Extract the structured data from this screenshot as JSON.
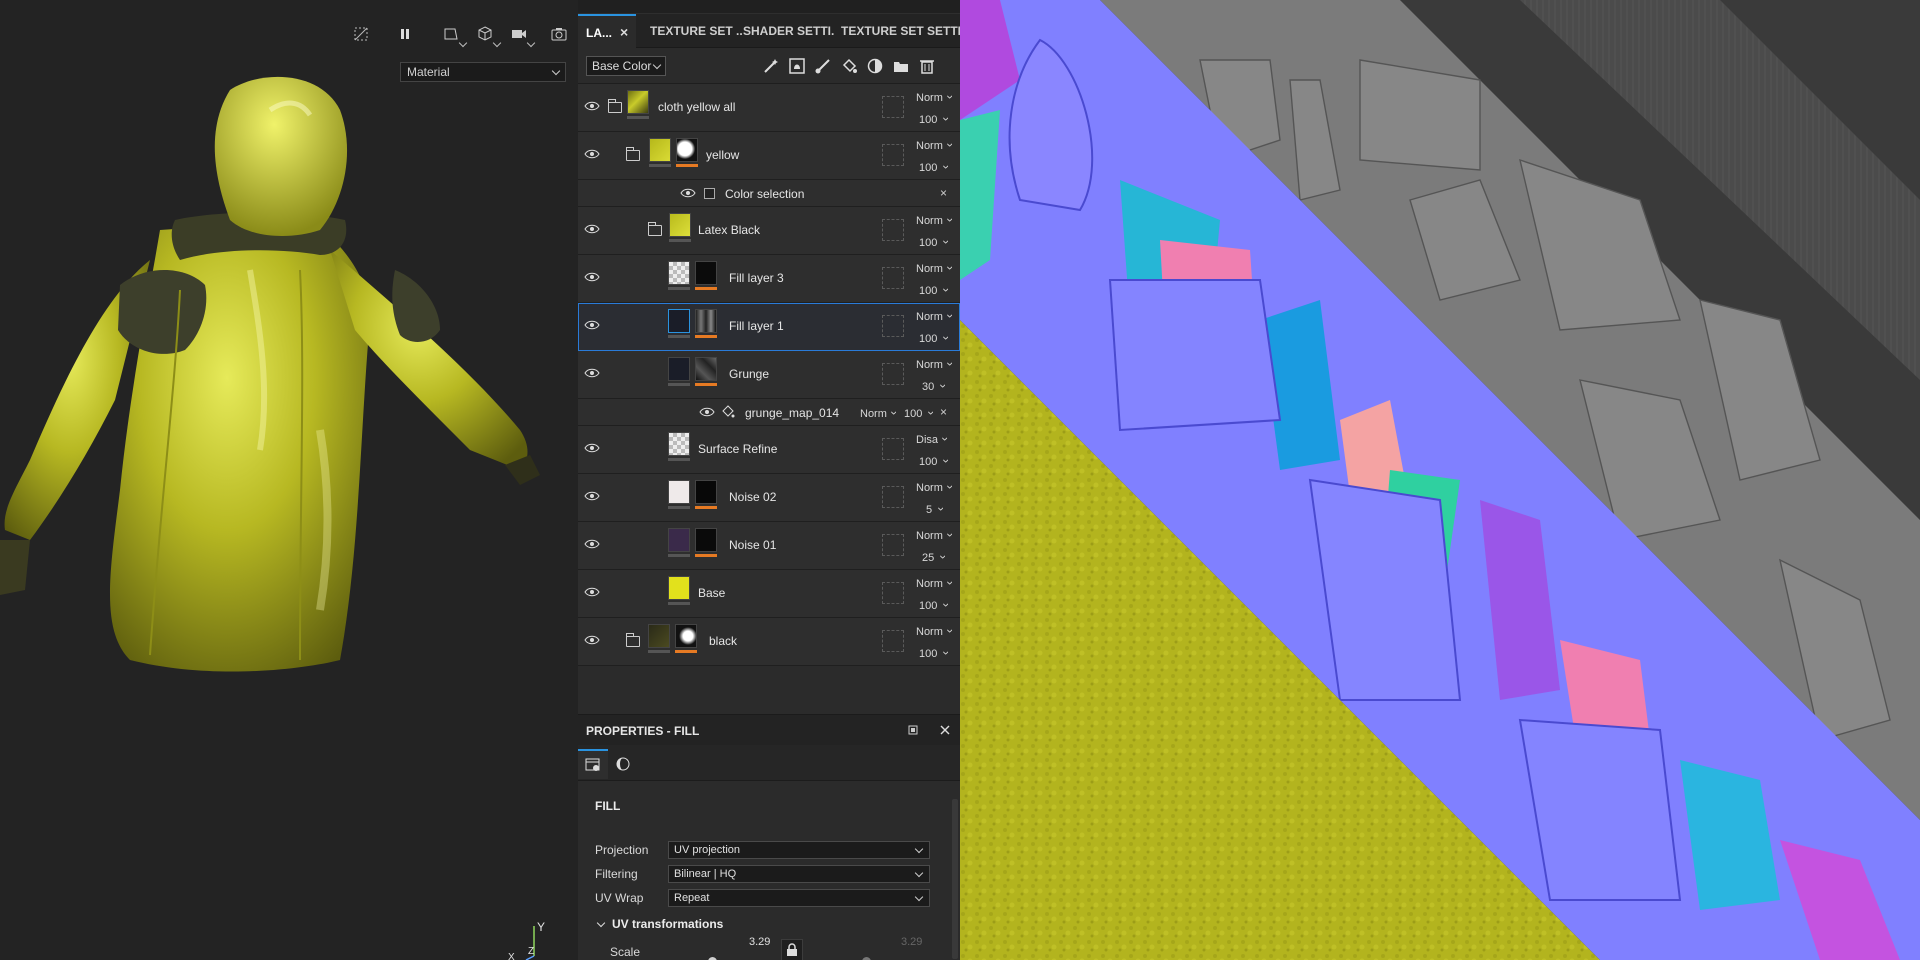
{
  "viewport": {
    "mode_select": "Material",
    "axis": {
      "y": "Y",
      "z": "Z",
      "x": "X"
    },
    "toolbar_icons": [
      "hide-icon",
      "pause-icon",
      "camera-frame-icon",
      "cube-icon",
      "video-camera-icon",
      "screenshot-icon"
    ]
  },
  "tabs": [
    {
      "label": "LA...",
      "active": true
    },
    {
      "label": "TEXTURE SET ...",
      "active": false
    },
    {
      "label": "SHADER SETTI...",
      "active": false
    },
    {
      "label": "TEXTURE SET SETTI...",
      "active": false
    }
  ],
  "tab_close": "×",
  "channel": "Base Color",
  "layer_tools": [
    "magic-wand-icon",
    "add-mask-icon",
    "paint-brush-icon",
    "fill-bucket-icon",
    "smart-material-icon",
    "folder-icon",
    "trash-icon"
  ],
  "layers": [
    {
      "name": "cloth yellow all",
      "blend": "Norm",
      "opacity": "100",
      "type": "folder",
      "indent": 0
    },
    {
      "name": "yellow",
      "blend": "Norm",
      "opacity": "100",
      "type": "folder",
      "indent": 1
    },
    {
      "name": "Color selection",
      "type": "effect",
      "close": "×"
    },
    {
      "name": "Latex Black",
      "blend": "Norm",
      "opacity": "100",
      "type": "folder",
      "indent": 2
    },
    {
      "name": "Fill layer 3",
      "blend": "Norm",
      "opacity": "100",
      "type": "fill",
      "indent": 3
    },
    {
      "name": "Fill layer 1",
      "blend": "Norm",
      "opacity": "100",
      "type": "fill",
      "indent": 3,
      "selected": true
    },
    {
      "name": "Grunge",
      "blend": "Norm",
      "opacity": "30",
      "type": "fill",
      "indent": 3
    },
    {
      "name": "grunge_map_014",
      "blend": "Norm",
      "opacity": "100",
      "type": "sub-fill",
      "close": "×"
    },
    {
      "name": "Surface Refine",
      "blend": "Disa",
      "opacity": "100",
      "type": "fill",
      "indent": 2
    },
    {
      "name": "Noise 02",
      "blend": "Norm",
      "opacity": "5",
      "type": "fill",
      "indent": 2
    },
    {
      "name": "Noise 01",
      "blend": "Norm",
      "opacity": "25",
      "type": "fill",
      "indent": 2
    },
    {
      "name": "Base",
      "blend": "Norm",
      "opacity": "100",
      "type": "fill",
      "indent": 2
    },
    {
      "name": "black",
      "blend": "Norm",
      "opacity": "100",
      "type": "folder",
      "indent": 1
    }
  ],
  "properties": {
    "title": "PROPERTIES - FILL",
    "section": "FILL",
    "fields": [
      {
        "label": "Projection",
        "value": "UV projection"
      },
      {
        "label": "Filtering",
        "value": "Bilinear | HQ"
      },
      {
        "label": "UV Wrap",
        "value": "Repeat"
      }
    ],
    "uv_transform_title": "UV transformations",
    "scale_label": "Scale",
    "scale_value": "3.29",
    "scale_value_locked": "3.29",
    "scale_fraction": 0.46
  },
  "colors": {
    "accent": "#2a93e0",
    "mask_bar": "#e67a23",
    "normal_map": "#8080ff",
    "base_yellow": "#b3b41e"
  }
}
